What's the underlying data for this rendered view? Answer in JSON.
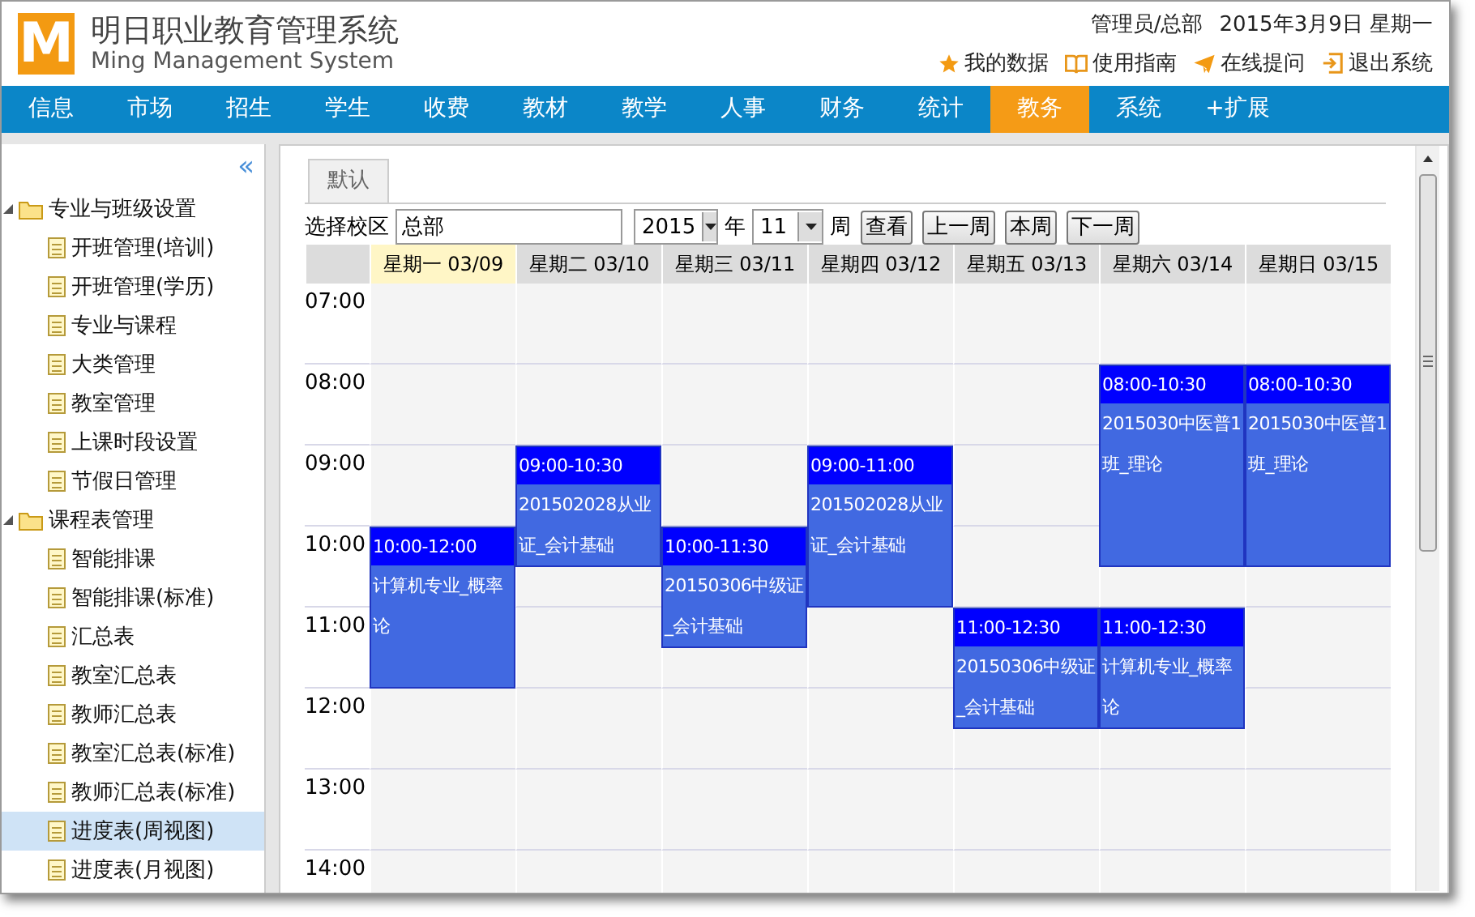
{
  "header": {
    "logo_mark": "M",
    "title": "明日职业教育管理系统",
    "subtitle": "Ming Management System",
    "user": "管理员/总部",
    "date": "2015年3月9日 星期一",
    "links": [
      {
        "kind": "star",
        "label": "我的数据"
      },
      {
        "kind": "book",
        "label": "使用指南"
      },
      {
        "kind": "plane",
        "label": "在线提问"
      },
      {
        "kind": "exit",
        "label": "退出系统"
      }
    ]
  },
  "nav": [
    {
      "label": "信息",
      "selected": false
    },
    {
      "label": "市场",
      "selected": false
    },
    {
      "label": "招生",
      "selected": false
    },
    {
      "label": "学生",
      "selected": false
    },
    {
      "label": "收费",
      "selected": false
    },
    {
      "label": "教材",
      "selected": false
    },
    {
      "label": "教学",
      "selected": false
    },
    {
      "label": "人事",
      "selected": false
    },
    {
      "label": "财务",
      "selected": false
    },
    {
      "label": "统计",
      "selected": false
    },
    {
      "label": "教务",
      "selected": true
    },
    {
      "label": "系统",
      "selected": false
    },
    {
      "label": "+扩展",
      "selected": false
    }
  ],
  "sidebar": {
    "collapse": "«",
    "tree": [
      {
        "label": "专业与班级设置",
        "expanded": true,
        "children": [
          {
            "label": "开班管理(培训)",
            "selected": false
          },
          {
            "label": "开班管理(学历)",
            "selected": false
          },
          {
            "label": "专业与课程",
            "selected": false
          },
          {
            "label": "大类管理",
            "selected": false
          },
          {
            "label": "教室管理",
            "selected": false
          },
          {
            "label": "上课时段设置",
            "selected": false
          },
          {
            "label": "节假日管理",
            "selected": false
          }
        ]
      },
      {
        "label": "课程表管理",
        "expanded": true,
        "children": [
          {
            "label": "智能排课",
            "selected": false
          },
          {
            "label": "智能排课(标准)",
            "selected": false
          },
          {
            "label": "汇总表",
            "selected": false
          },
          {
            "label": "教室汇总表",
            "selected": false
          },
          {
            "label": "教师汇总表",
            "selected": false
          },
          {
            "label": "教室汇总表(标准)",
            "selected": false
          },
          {
            "label": "教师汇总表(标准)",
            "selected": false
          },
          {
            "label": "进度表(周视图)",
            "selected": true
          },
          {
            "label": "进度表(月视图)",
            "selected": false
          }
        ]
      }
    ]
  },
  "tabs": [
    {
      "label": "默认",
      "selected": true
    }
  ],
  "toolbar": {
    "campus_label": "选择校区",
    "campus": "总部",
    "year": "2015",
    "year_unit": "年",
    "week": "11",
    "week_unit": "周",
    "buttons": [
      "查看",
      "上一周",
      "本周",
      "下一周"
    ]
  },
  "calendar": {
    "hours": [
      "07:00",
      "08:00",
      "09:00",
      "10:00",
      "11:00",
      "12:00",
      "13:00",
      "14:00"
    ],
    "days": [
      {
        "label": "星期一 03/09",
        "highlighted": true,
        "events": [
          {
            "time": "10:00-12:00",
            "title": "计算机专业_概率论"
          }
        ]
      },
      {
        "label": "星期二 03/10",
        "highlighted": false,
        "events": [
          {
            "time": "09:00-10:30",
            "title": "201502028从业证_会计基础"
          }
        ]
      },
      {
        "label": "星期三 03/11",
        "highlighted": false,
        "events": [
          {
            "time": "10:00-11:30",
            "title": "20150306中级证_会计基础"
          }
        ]
      },
      {
        "label": "星期四 03/12",
        "highlighted": false,
        "events": [
          {
            "time": "09:00-11:00",
            "title": "201502028从业证_会计基础"
          }
        ]
      },
      {
        "label": "星期五 03/13",
        "highlighted": false,
        "events": [
          {
            "time": "11:00-12:30",
            "title": "20150306中级证_会计基础"
          }
        ]
      },
      {
        "label": "星期六 03/14",
        "highlighted": false,
        "events": [
          {
            "time": "08:00-10:30",
            "title": "2015030中医普1班_理论"
          },
          {
            "time": "11:00-12:30",
            "title": "计算机专业_概率论"
          }
        ]
      },
      {
        "label": "星期日 03/15",
        "highlighted": false,
        "events": [
          {
            "time": "08:00-10:30",
            "title": "2015030中医普1班_理论"
          }
        ]
      }
    ]
  }
}
